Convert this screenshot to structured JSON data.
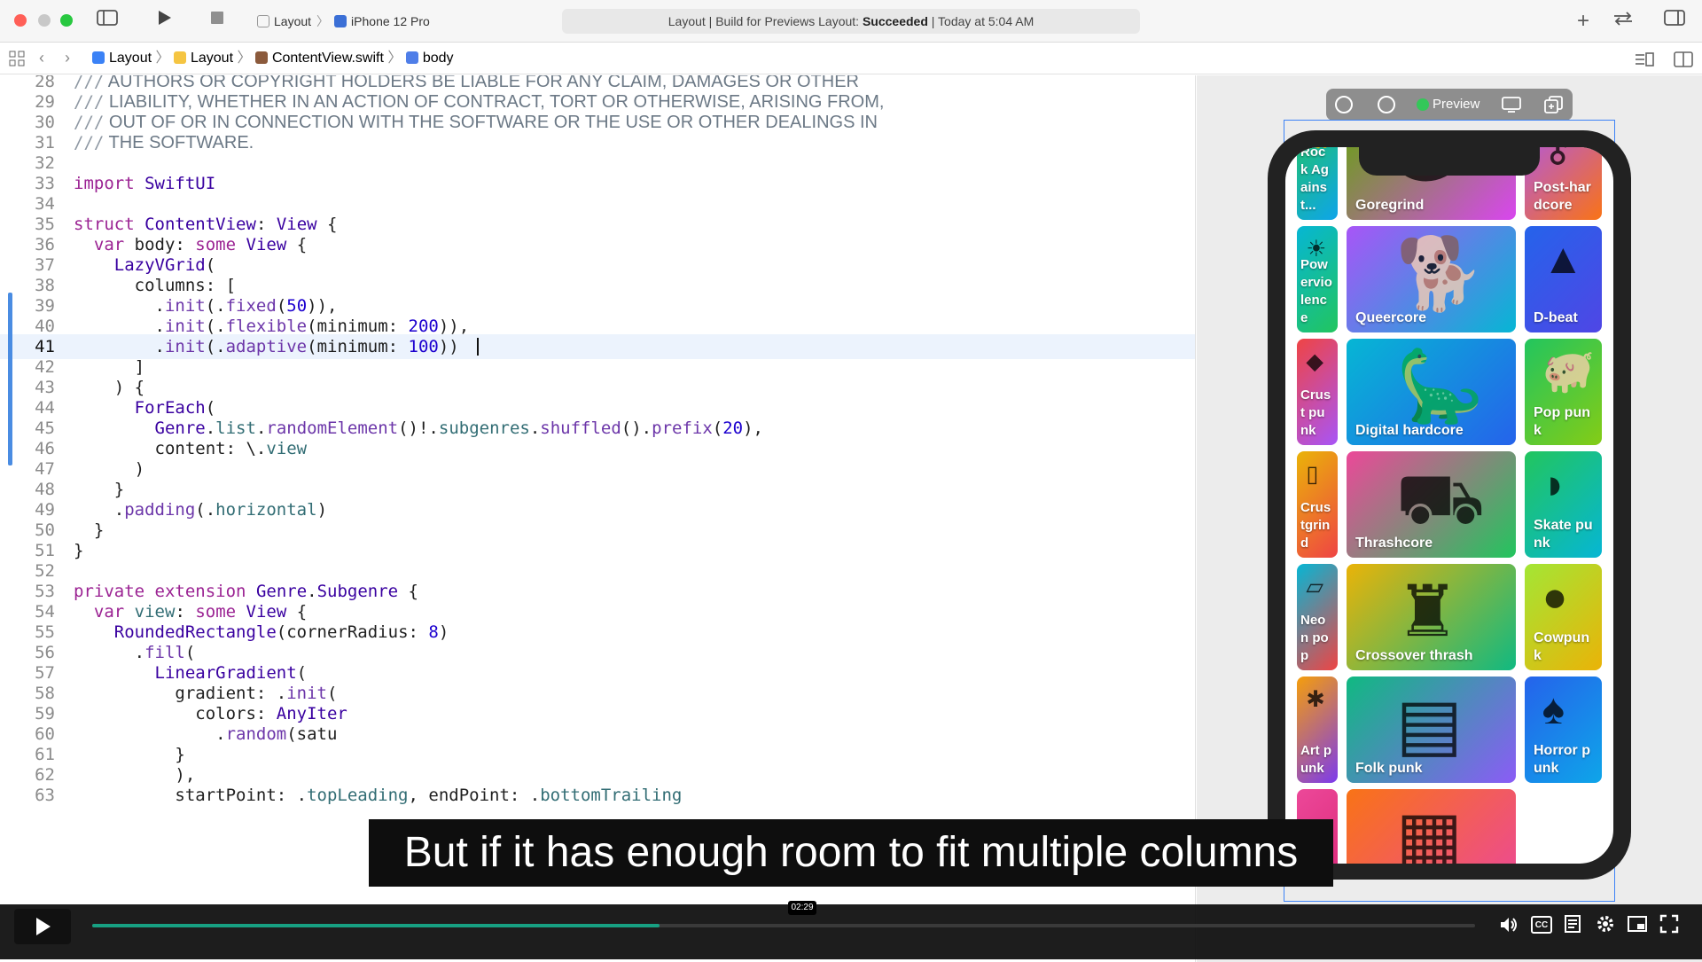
{
  "toolbar": {
    "scheme_target": "Layout",
    "scheme_device": "iPhone 12 Pro",
    "status_prefix": "Layout | Build for Previews Layout: ",
    "status_bold": "Succeeded",
    "status_suffix": " | Today at 5:04 AM"
  },
  "jumpbar": {
    "crumbs": [
      "Layout",
      "Layout",
      "ContentView.swift",
      "body"
    ]
  },
  "editor": {
    "lines": [
      {
        "n": "28",
        "c": "/// AUTHORS OR COPYRIGHT HOLDERS BE LIABLE FOR ANY CLAIM, DAMAGES OR OTHER"
      },
      {
        "n": "29",
        "c": "/// LIABILITY, WHETHER IN AN ACTION OF CONTRACT, TORT OR OTHERWISE, ARISING FROM,"
      },
      {
        "n": "30",
        "c": "/// OUT OF OR IN CONNECTION WITH THE SOFTWARE OR THE USE OR OTHER DEALINGS IN"
      },
      {
        "n": "31",
        "c": "/// THE SOFTWARE."
      },
      {
        "n": "32",
        "c": ""
      },
      {
        "n": "33",
        "c": "import SwiftUI"
      },
      {
        "n": "34",
        "c": ""
      },
      {
        "n": "35",
        "c": "struct ContentView: View {"
      },
      {
        "n": "36",
        "c": "  var body: some View {"
      },
      {
        "n": "37",
        "c": "    LazyVGrid("
      },
      {
        "n": "38",
        "c": "      columns: ["
      },
      {
        "n": "39",
        "c": "        .init(.fixed(50)),"
      },
      {
        "n": "40",
        "c": "        .init(.flexible(minimum: 200)),"
      },
      {
        "n": "41",
        "c": "        .init(.adaptive(minimum: 100))"
      },
      {
        "n": "42",
        "c": "      ]"
      },
      {
        "n": "43",
        "c": "    ) {"
      },
      {
        "n": "44",
        "c": "      ForEach("
      },
      {
        "n": "45",
        "c": "        Genre.list.randomElement()!.subgenres.shuffled().prefix(20),"
      },
      {
        "n": "46",
        "c": "        content: \\.view"
      },
      {
        "n": "47",
        "c": "      )"
      },
      {
        "n": "48",
        "c": "    }"
      },
      {
        "n": "49",
        "c": "    .padding(.horizontal)"
      },
      {
        "n": "50",
        "c": "  }"
      },
      {
        "n": "51",
        "c": "}"
      },
      {
        "n": "52",
        "c": ""
      },
      {
        "n": "53",
        "c": "private extension Genre.Subgenre {"
      },
      {
        "n": "54",
        "c": "  var view: some View {"
      },
      {
        "n": "55",
        "c": "    RoundedRectangle(cornerRadius: 8)"
      },
      {
        "n": "56",
        "c": "      .fill("
      },
      {
        "n": "57",
        "c": "        LinearGradient("
      },
      {
        "n": "58",
        "c": "          gradient: .init("
      },
      {
        "n": "59",
        "c": "            colors: AnyIter"
      },
      {
        "n": "60",
        "c": "              .random(satu"
      },
      {
        "n": "61",
        "c": "          }"
      },
      {
        "n": "62",
        "c": "          ),"
      },
      {
        "n": "63",
        "c": "          startPoint: .topLeading, endPoint: .bottomTrailing"
      }
    ],
    "current_line": "41"
  },
  "preview": {
    "label": "Preview",
    "tiles": [
      {
        "label": "Rock Against...",
        "icon": "tile-art-cat-icon",
        "colors": [
          "#22c55e",
          "#0ea5e9"
        ]
      },
      {
        "label": "Goregrind",
        "icon": "tile-art-rock-icon",
        "colors": [
          "#65a30d",
          "#d946ef"
        ]
      },
      {
        "label": "Post-hardcore",
        "icon": "tile-art-key-icon",
        "colors": [
          "#a855f7",
          "#f97316"
        ]
      },
      {
        "label": "Powerviolence",
        "icon": "tile-art-sun-icon",
        "colors": [
          "#06b6d4",
          "#22c55e"
        ]
      },
      {
        "label": "Queercore",
        "icon": "tile-art-dog-icon",
        "colors": [
          "#a855f7",
          "#06b6d4"
        ]
      },
      {
        "label": "D-beat",
        "icon": "tile-art-tent-icon",
        "colors": [
          "#2563eb",
          "#4f46e5"
        ]
      },
      {
        "label": "Crust punk",
        "icon": "tile-art-sign-icon",
        "colors": [
          "#ef4444",
          "#a855f7"
        ]
      },
      {
        "label": "Digital hardcore",
        "icon": "tile-art-dino-icon",
        "colors": [
          "#06b6d4",
          "#2563eb"
        ]
      },
      {
        "label": "Pop punk",
        "icon": "tile-art-pig-icon",
        "colors": [
          "#22c55e",
          "#84cc16"
        ]
      },
      {
        "label": "Crustgrind",
        "icon": "tile-art-door-icon",
        "colors": [
          "#eab308",
          "#ef4444"
        ]
      },
      {
        "label": "Thrashcore",
        "icon": "tile-art-bag-icon",
        "colors": [
          "#ec4899",
          "#22c55e"
        ]
      },
      {
        "label": "Skate punk",
        "icon": "tile-art-sock-icon",
        "colors": [
          "#22c55e",
          "#06b6d4"
        ]
      },
      {
        "label": "Neon pop",
        "icon": "tile-art-ticket-icon",
        "colors": [
          "#06b6d4",
          "#ef4444"
        ]
      },
      {
        "label": "Crossover thrash",
        "icon": "tile-art-castle-icon",
        "colors": [
          "#eab308",
          "#10b981"
        ]
      },
      {
        "label": "Cowpunk",
        "icon": "tile-art-fruit-icon",
        "colors": [
          "#a3e635",
          "#eab308"
        ]
      },
      {
        "label": "Art punk",
        "icon": "tile-art-bug-icon",
        "colors": [
          "#f59e0b",
          "#7c3aed"
        ]
      },
      {
        "label": "Folk punk",
        "icon": "tile-art-menu-icon",
        "colors": [
          "#10b981",
          "#8b5cf6"
        ]
      },
      {
        "label": "Horror punk",
        "icon": "tile-art-mushroom-icon",
        "colors": [
          "#2563eb",
          "#0ea5e9"
        ]
      },
      {
        "label": "",
        "icon": "tile-art-pink-icon",
        "colors": [
          "#ec4899",
          "#db2777"
        ]
      },
      {
        "label": "",
        "icon": "tile-art-shelf-icon",
        "colors": [
          "#f97316",
          "#ec4899"
        ]
      }
    ]
  },
  "caption": {
    "text": "But if it has enough room to fit multiple columns"
  },
  "video": {
    "time": "02:29",
    "progress": 0.41
  }
}
